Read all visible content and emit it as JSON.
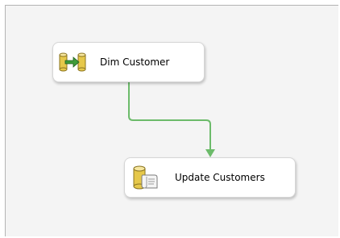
{
  "tasks": [
    {
      "label": "Dim Customer",
      "icon": "data-flow-icon"
    },
    {
      "label": "Update Customers",
      "icon": "sql-task-icon"
    }
  ],
  "connector": {
    "color": "#6cbb6a"
  }
}
